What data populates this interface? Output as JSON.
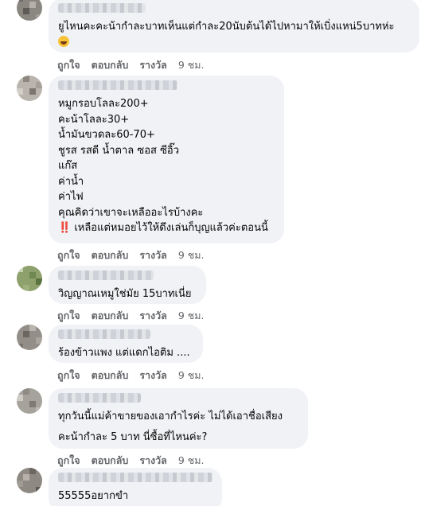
{
  "comments": [
    {
      "lines": [
        "ยูไหนคะคะน้ากำละบาทเห็นแต่กำละ20นับต้นได้ไปหามาให้เบิ่งแหน่5บาทห่ะ"
      ],
      "emoji": "laughing-tears",
      "actions": {
        "like": "ถูกใจ",
        "reply": "ตอบกลับ",
        "award": "รางวัล",
        "time": "9 ชม."
      }
    },
    {
      "lines": [
        "หมูกรอบโลละ200+",
        "คะน้าโลละ30+",
        "น้ำมันขวดละ60-70+",
        "ชูรส รสดี น้ำตาล ซอส ซีอิ๊ว",
        "แก๊ส",
        "ค่าน้ำ",
        "ค่าไฟ",
        "คุณคิดว่าเขาจะเหลืออะไรบ้างคะ",
        "‼️ เหลือแต่หมอยไว้ให้ดึงเล่นก็บุญแล้วค่ะตอนนี้"
      ],
      "actions": {
        "like": "ถูกใจ",
        "reply": "ตอบกลับ",
        "award": "รางวัล",
        "time": "9 ชม."
      }
    },
    {
      "lines": [
        "วิญญาณเหมูใช่มัย 15บาทเนี่ย"
      ],
      "actions": {
        "like": "ถูกใจ",
        "reply": "ตอบกลับ",
        "award": "รางวัล",
        "time": "9 ชม."
      }
    },
    {
      "lines": [
        "ร้องข้าวแพง แต่แดกไอติม ...."
      ],
      "actions": {
        "like": "ถูกใจ",
        "reply": "ตอบกลับ",
        "award": "รางวัล",
        "time": "9 ชม."
      }
    },
    {
      "lines": [
        "ทุกวันนี้แม่ค้าขายของเอากำไรค่ะ ไม่ได้เอาชื่อเสียง",
        "คะน้ากำละ 5 บาท นี่ซื้อที่ไหนค่ะ?"
      ],
      "actions": {
        "like": "ถูกใจ",
        "reply": "ตอบกลับ",
        "award": "รางวัล",
        "time": "9 ชม."
      }
    },
    {
      "lines": [
        "55555อยากขำ"
      ]
    }
  ]
}
